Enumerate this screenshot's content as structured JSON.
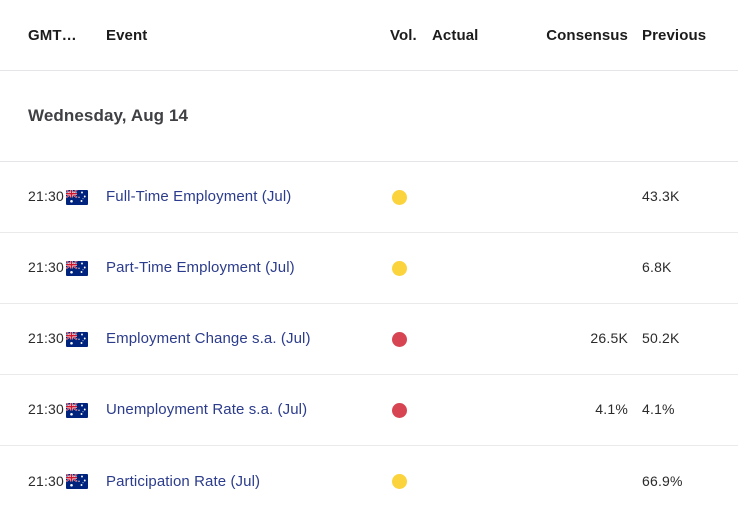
{
  "table": {
    "columns": {
      "time": "GMT…",
      "event": "Event",
      "volatility": "Vol.",
      "actual": "Actual",
      "consensus": "Consensus",
      "previous": "Previous"
    },
    "date_group": "Wednesday, Aug 14",
    "rows": [
      {
        "time": "21:30",
        "country": "Australia",
        "flag_icon": "australia-flag-icon",
        "event": "Full-Time Employment (Jul)",
        "volatility": "moderate",
        "volatility_icon": "yellow-dot-icon",
        "actual": "",
        "consensus": "",
        "previous": "43.3K"
      },
      {
        "time": "21:30",
        "country": "Australia",
        "flag_icon": "australia-flag-icon",
        "event": "Part-Time Employment (Jul)",
        "volatility": "moderate",
        "volatility_icon": "yellow-dot-icon",
        "actual": "",
        "consensus": "",
        "previous": "6.8K"
      },
      {
        "time": "21:30",
        "country": "Australia",
        "flag_icon": "australia-flag-icon",
        "event": "Employment Change s.a. (Jul)",
        "volatility": "high",
        "volatility_icon": "red-dot-icon",
        "actual": "",
        "consensus": "26.5K",
        "previous": "50.2K"
      },
      {
        "time": "21:30",
        "country": "Australia",
        "flag_icon": "australia-flag-icon",
        "event": "Unemployment Rate s.a. (Jul)",
        "volatility": "high",
        "volatility_icon": "red-dot-icon",
        "actual": "",
        "consensus": "4.1%",
        "previous": "4.1%"
      },
      {
        "time": "21:30",
        "country": "Australia",
        "flag_icon": "australia-flag-icon",
        "event": "Participation Rate (Jul)",
        "volatility": "moderate",
        "volatility_icon": "yellow-dot-icon",
        "actual": "",
        "consensus": "",
        "previous": "66.9%"
      }
    ]
  },
  "colors": {
    "event_link": "#2c3c8c",
    "volatility_moderate": "#fbd33c",
    "volatility_high": "#d84552",
    "row_border": "#e8eaec",
    "header_border": "#e3e5e8",
    "date_title": "#3f4044",
    "background": "#ffffff"
  }
}
